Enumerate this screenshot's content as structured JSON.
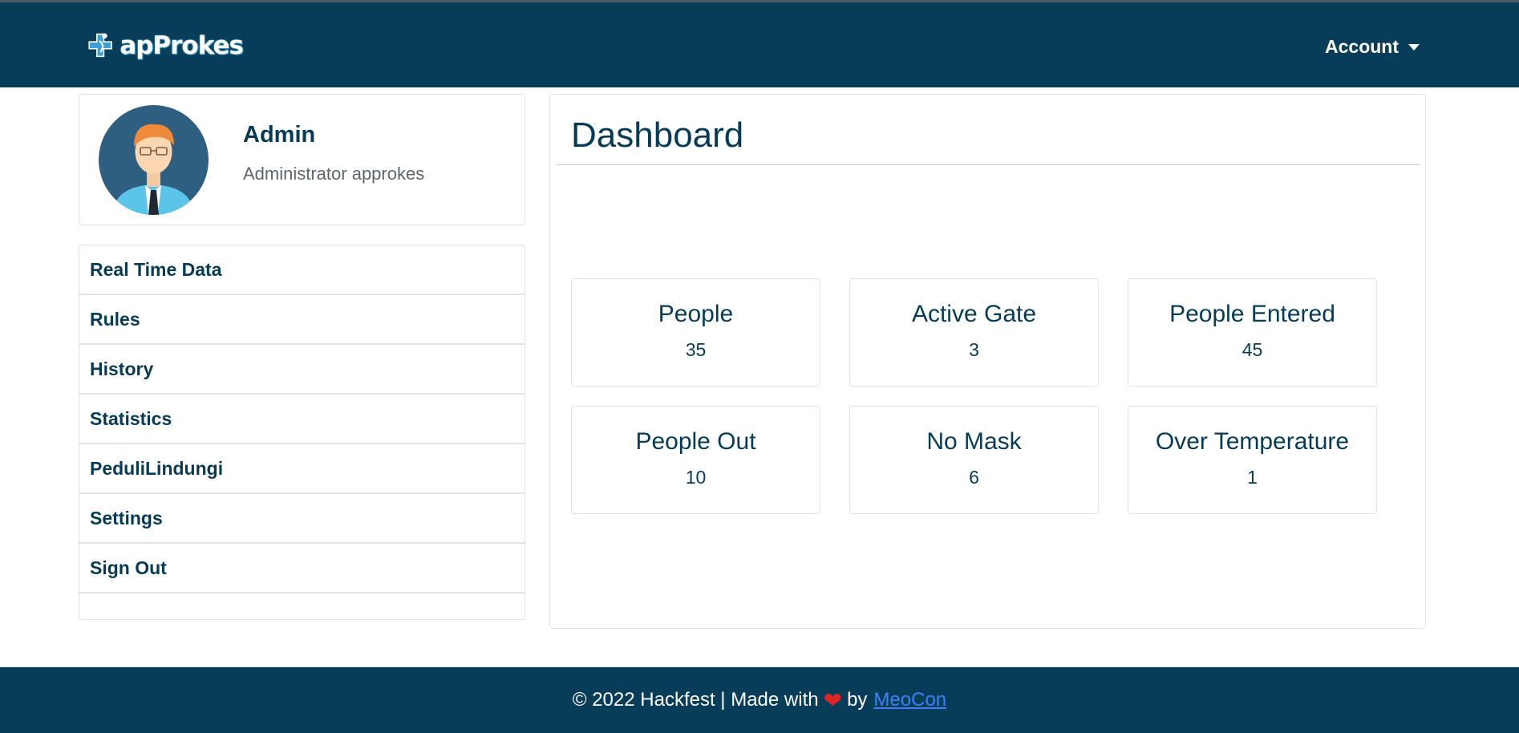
{
  "navbar": {
    "logo_text": "apProkes",
    "account_label": "Account"
  },
  "profile": {
    "name": "Admin",
    "role": "Administrator approkes"
  },
  "menu": {
    "items": [
      {
        "label": "Real Time Data"
      },
      {
        "label": "Rules"
      },
      {
        "label": "History"
      },
      {
        "label": "Statistics"
      },
      {
        "label": "PeduliLindungi"
      },
      {
        "label": "Settings"
      },
      {
        "label": "Sign Out"
      }
    ]
  },
  "dashboard": {
    "title": "Dashboard",
    "stats": [
      {
        "label": "People",
        "value": "35"
      },
      {
        "label": "Active Gate",
        "value": "3"
      },
      {
        "label": "People Entered",
        "value": "45"
      },
      {
        "label": "People Out",
        "value": "10"
      },
      {
        "label": "No Mask",
        "value": "6"
      },
      {
        "label": "Over Temperature",
        "value": "1"
      }
    ]
  },
  "footer": {
    "text_before": "© 2022 Hackfest | Made with",
    "heart": "❤",
    "text_by": "by",
    "link_text": "MeoCon"
  },
  "colors": {
    "navy": "#073d59",
    "link": "#3b82f6",
    "heart": "#e02424"
  }
}
